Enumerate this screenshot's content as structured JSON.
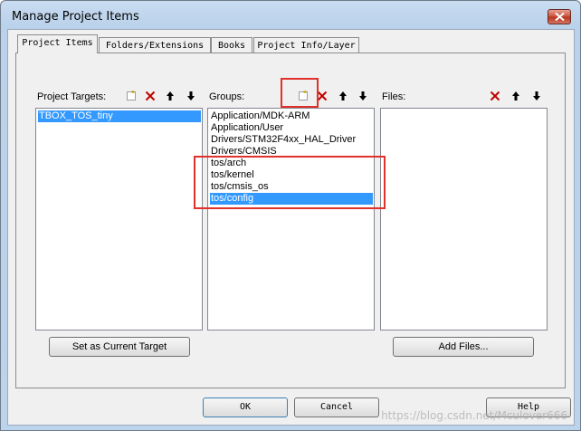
{
  "window": {
    "title": "Manage Project Items"
  },
  "tabs": [
    {
      "label": "Project Items"
    },
    {
      "label": "Folders/Extensions"
    },
    {
      "label": "Books"
    },
    {
      "label": "Project Info/Layer"
    }
  ],
  "targets": {
    "label": "Project Targets:",
    "items": [
      "TBOX_TOS_tiny"
    ],
    "selected_index": 0,
    "button": "Set as Current Target"
  },
  "groups": {
    "label": "Groups:",
    "items": [
      "Application/MDK-ARM",
      "Application/User",
      "Drivers/STM32F4xx_HAL_Driver",
      "Drivers/CMSIS",
      "tos/arch",
      "tos/kernel",
      "tos/cmsis_os",
      "tos/config"
    ],
    "selected_index": 7
  },
  "files": {
    "label": "Files:",
    "items": [],
    "button": "Add Files..."
  },
  "footer": {
    "ok": "OK",
    "cancel": "Cancel",
    "help": "Help"
  },
  "watermark": "https://blog.csdn.net/Mculover666",
  "colors": {
    "highlight": "#e0312b",
    "selection": "#3399ff"
  }
}
